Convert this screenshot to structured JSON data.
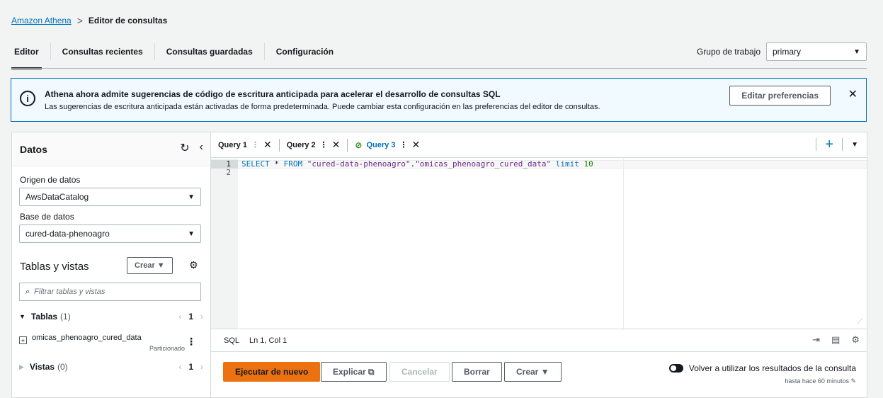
{
  "breadcrumb": {
    "root": "Amazon Athena",
    "separator": ">",
    "current": "Editor de consultas"
  },
  "top_tabs": [
    "Editor",
    "Consultas recientes",
    "Consultas guardadas",
    "Configuración"
  ],
  "workgroup": {
    "label": "Grupo de trabajo",
    "value": "primary"
  },
  "banner": {
    "title": "Athena ahora admite sugerencias de código de escritura anticipada para acelerar el desarrollo de consultas SQL",
    "message": "Las sugerencias de escritura anticipada están activadas de forma predeterminada. Puede cambiar esta configuración en las preferencias del editor de consultas.",
    "button": "Editar preferencias",
    "icon_glyph": "i",
    "close_glyph": "✕"
  },
  "left": {
    "title": "Datos",
    "source_label": "Origen de datos",
    "source_value": "AwsDataCatalog",
    "db_label": "Base de datos",
    "db_value": "cured-data-phenoagro",
    "tables_title": "Tablas y vistas",
    "create_button": "Crear ▼",
    "filter_placeholder": "Filtrar tablas y vistas",
    "tables": {
      "label": "Tablas",
      "count": "(1)",
      "page": "1"
    },
    "table_item": {
      "name": "omicas_phenoagro_cured_data",
      "badge": "Particionado"
    },
    "views": {
      "label": "Vistas",
      "count": "(0)",
      "page": "1"
    }
  },
  "query_tabs": [
    {
      "label": "Query 1"
    },
    {
      "label": "Query 2"
    },
    {
      "label": "Query 3"
    }
  ],
  "editor": {
    "line_numbers": [
      "1",
      "2"
    ],
    "code": {
      "kw1": "SELECT",
      "star": " * ",
      "kw2": "FROM",
      "str1": " \"cured-data-phenoagro\"",
      "dot": ".",
      "str2": "\"omicas_phenoagro_cured_data\"",
      "kw3": " limit ",
      "num": "10"
    }
  },
  "status": {
    "mode": "SQL",
    "position": "Ln 1, Col 1"
  },
  "actions": {
    "run": "Ejecutar de nuevo",
    "explain": "Explicar ⧉",
    "cancel": "Cancelar",
    "clear": "Borrar",
    "create": "Crear ▼"
  },
  "reuse": {
    "label": "Volver a utilizar los resultados de la consulta",
    "sub": "hasta hace 60 minutos ✎"
  },
  "colors": {
    "accent": "#ec7211",
    "link": "#0073bb",
    "success": "#1d8102"
  }
}
